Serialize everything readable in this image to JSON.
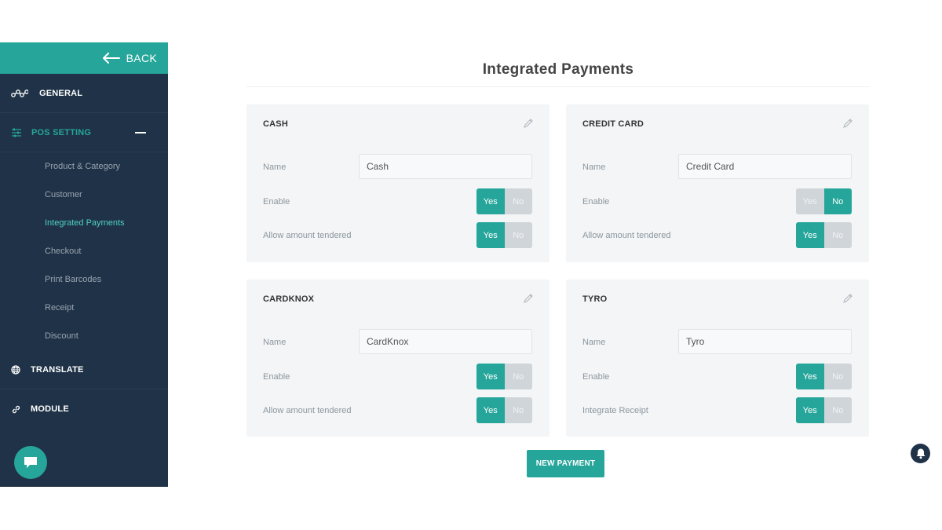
{
  "sidebar": {
    "back_label": "BACK",
    "general_label": "GENERAL",
    "pos_setting_label": "POS SETTING",
    "sub_items": [
      {
        "label": "Product & Category"
      },
      {
        "label": "Customer"
      },
      {
        "label": "Integrated Payments",
        "active": true
      },
      {
        "label": "Checkout"
      },
      {
        "label": "Print Barcodes"
      },
      {
        "label": "Receipt"
      },
      {
        "label": "Discount"
      }
    ],
    "translate_label": "TRANSLATE",
    "module_label": "MODULE"
  },
  "page": {
    "title": "Integrated Payments",
    "new_payment_label": "NEW PAYMENT"
  },
  "cards": [
    {
      "title": "CASH",
      "name_label": "Name",
      "name_value": "Cash",
      "row2_label": "Enable",
      "row2_value": "Yes",
      "row3_label": "Allow amount tendered",
      "row3_value": "Yes",
      "yes_label": "Yes",
      "no_label": "No"
    },
    {
      "title": "CREDIT CARD",
      "name_label": "Name",
      "name_value": "Credit Card",
      "row2_label": "Enable",
      "row2_value": "No",
      "row3_label": "Allow amount tendered",
      "row3_value": "Yes",
      "yes_label": "Yes",
      "no_label": "No"
    },
    {
      "title": "CARDKNOX",
      "name_label": "Name",
      "name_value": "CardKnox",
      "row2_label": "Enable",
      "row2_value": "Yes",
      "row3_label": "Allow amount tendered",
      "row3_value": "Yes",
      "yes_label": "Yes",
      "no_label": "No"
    },
    {
      "title": "TYRO",
      "name_label": "Name",
      "name_value": "Tyro",
      "row2_label": "Enable",
      "row2_value": "Yes",
      "row3_label": "Integrate Receipt",
      "row3_value": "Yes",
      "yes_label": "Yes",
      "no_label": "No"
    }
  ],
  "colors": {
    "accent": "#26a69a",
    "sidebar_bg": "#1f3247",
    "card_bg": "#f3f5f6",
    "toggle_off": "#cfd5d9"
  },
  "icons": {
    "back": "arrow-left-icon",
    "general": "nodes-icon",
    "pos_setting": "sliders-icon",
    "translate": "globe-icon",
    "module": "link-icon",
    "edit": "pencil-icon",
    "chat": "chat-icon",
    "notifications": "bell-icon"
  }
}
